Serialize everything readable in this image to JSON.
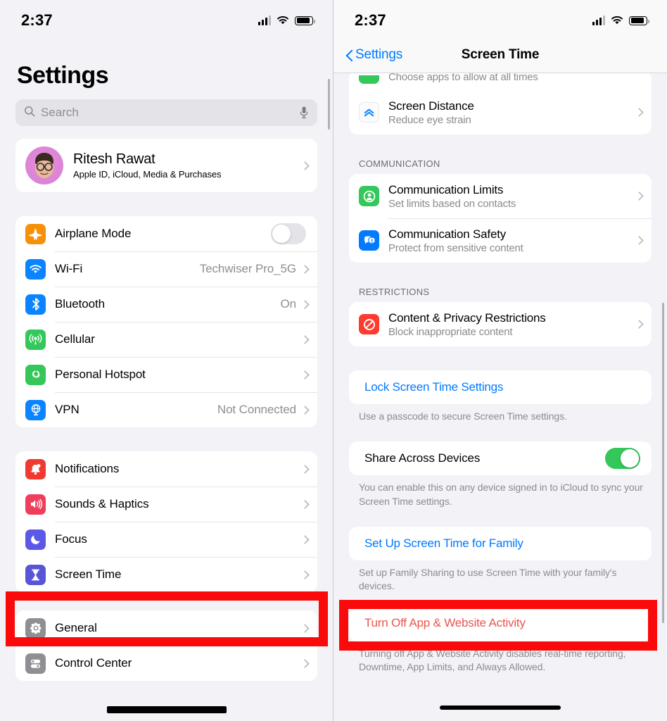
{
  "left": {
    "status": {
      "time": "2:37",
      "cellular_icon": "cellular-bars-icon",
      "wifi_icon": "wifi-icon",
      "battery_icon": "battery-icon"
    },
    "title": "Settings",
    "search": {
      "placeholder": "Search",
      "icon": "search-icon",
      "mic_icon": "microphone-icon"
    },
    "profile": {
      "name": "Ritesh Rawat",
      "subtitle": "Apple ID, iCloud, Media & Purchases",
      "avatar": "memoji-avatar",
      "chevron": "chevron-right-icon"
    },
    "group_connectivity": [
      {
        "label": "Airplane Mode",
        "icon": "airplane-icon",
        "color": "#f79009",
        "control": "toggle",
        "toggle_on": false
      },
      {
        "label": "Wi-Fi",
        "icon": "wifi-icon",
        "color": "#0a84ff",
        "value": "Techwiser Pro_5G",
        "control": "chevron"
      },
      {
        "label": "Bluetooth",
        "icon": "bluetooth-icon",
        "color": "#0a84ff",
        "value": "On",
        "control": "chevron"
      },
      {
        "label": "Cellular",
        "icon": "cellular-antenna-icon",
        "color": "#34c759",
        "value": "",
        "control": "chevron"
      },
      {
        "label": "Personal Hotspot",
        "icon": "hotspot-link-icon",
        "color": "#34c759",
        "value": "",
        "control": "chevron"
      },
      {
        "label": "VPN",
        "icon": "vpn-globe-icon",
        "color": "#0a84ff",
        "value": "Not Connected",
        "control": "chevron"
      }
    ],
    "group_system": [
      {
        "label": "Notifications",
        "icon": "notifications-bell-icon",
        "color": "#f03a2f",
        "value": "",
        "control": "chevron"
      },
      {
        "label": "Sounds & Haptics",
        "icon": "sounds-speaker-icon",
        "color": "#ef3e5c",
        "value": "",
        "control": "chevron"
      },
      {
        "label": "Focus",
        "icon": "focus-moon-icon",
        "color": "#5a5ae6",
        "value": "",
        "control": "chevron"
      },
      {
        "label": "Screen Time",
        "icon": "screen-time-hourglass-icon",
        "color": "#5856d6",
        "value": "",
        "control": "chevron"
      }
    ],
    "group_general": [
      {
        "label": "General",
        "icon": "general-gear-icon",
        "color": "#8e8e93",
        "value": "",
        "control": "chevron"
      },
      {
        "label": "Control Center",
        "icon": "control-center-icon",
        "color": "#8e8e93",
        "value": "",
        "control": "chevron"
      }
    ],
    "highlight_target": "Screen Time"
  },
  "right": {
    "status": {
      "time": "2:37"
    },
    "nav": {
      "back_label": "Settings",
      "title": "Screen Time",
      "back_icon": "chevron-left-icon"
    },
    "clipped_row": {
      "subtitle": "Choose apps to allow at all times",
      "icon": "always-allowed-icon",
      "color": "#34c759"
    },
    "screen_distance": {
      "title": "Screen Distance",
      "subtitle": "Reduce eye strain",
      "icon": "screen-distance-chevrons-icon",
      "color": "#ffffff"
    },
    "communication": {
      "header": "COMMUNICATION",
      "items": [
        {
          "title": "Communication Limits",
          "subtitle": "Set limits based on contacts",
          "icon": "communication-limits-person-icon",
          "color": "#34c759"
        },
        {
          "title": "Communication Safety",
          "subtitle": "Protect from sensitive content",
          "icon": "communication-safety-bubbles-icon",
          "color": "#007aff"
        }
      ]
    },
    "restrictions": {
      "header": "RESTRICTIONS",
      "items": [
        {
          "title": "Content & Privacy Restrictions",
          "subtitle": "Block inappropriate content",
          "icon": "content-privacy-block-icon",
          "color": "#ff3b30"
        }
      ]
    },
    "lock": {
      "link": "Lock Screen Time Settings",
      "footnote": "Use a passcode to secure Screen Time settings."
    },
    "share": {
      "label": "Share Across Devices",
      "toggle_on": true,
      "footnote": "You can enable this on any device signed in to iCloud to sync your Screen Time settings."
    },
    "family": {
      "link": "Set Up Screen Time for Family",
      "footnote": "Set up Family Sharing to use Screen Time with your family's devices."
    },
    "turn_off": {
      "link": "Turn Off App & Website Activity",
      "footnote": "Turning off App & Website Activity disables real-time reporting, Downtime, App Limits, and Always Allowed."
    },
    "highlight_target": "Turn Off App & Website Activity"
  },
  "annotation": {
    "box_color": "#fa0a0a"
  }
}
